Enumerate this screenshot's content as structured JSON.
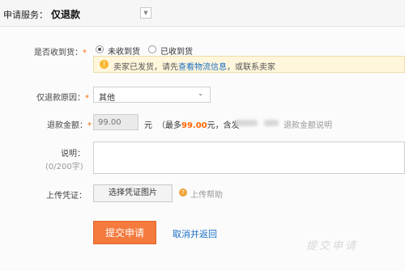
{
  "header": {
    "service_label": "申请服务：",
    "service_value": "仅退款"
  },
  "received": {
    "label": "是否收到货：",
    "required_mark": "*",
    "options": [
      "未收到货",
      "已收到货"
    ],
    "selected": "未收到货"
  },
  "notice": {
    "text_before": "卖家已发货，请先",
    "link_text": "查看物流信息",
    "text_after": "，或联系卖家"
  },
  "reason": {
    "label": "仅退款原因：",
    "required_mark": "*",
    "selected": "其他"
  },
  "amount": {
    "label": "退款金额：",
    "required_mark": "*",
    "value": "99.00",
    "unit": "元",
    "max_prefix": "（最多",
    "max_value": "99.00",
    "max_suffix": "元，含发",
    "explain_link": "退款金额说明"
  },
  "description": {
    "label": "说明：",
    "counter": "(0/200字)"
  },
  "upload": {
    "label": "上传凭证：",
    "button": "选择凭证图片",
    "help": "上传帮助"
  },
  "actions": {
    "submit": "提交申请",
    "cancel": "取消并返回"
  },
  "watermark": "提交申请",
  "colors": {
    "accent_orange": "#f47a3e",
    "link_blue": "#1a6fc4",
    "required": "#ff6600",
    "notice_bg": "#fff6dc"
  }
}
